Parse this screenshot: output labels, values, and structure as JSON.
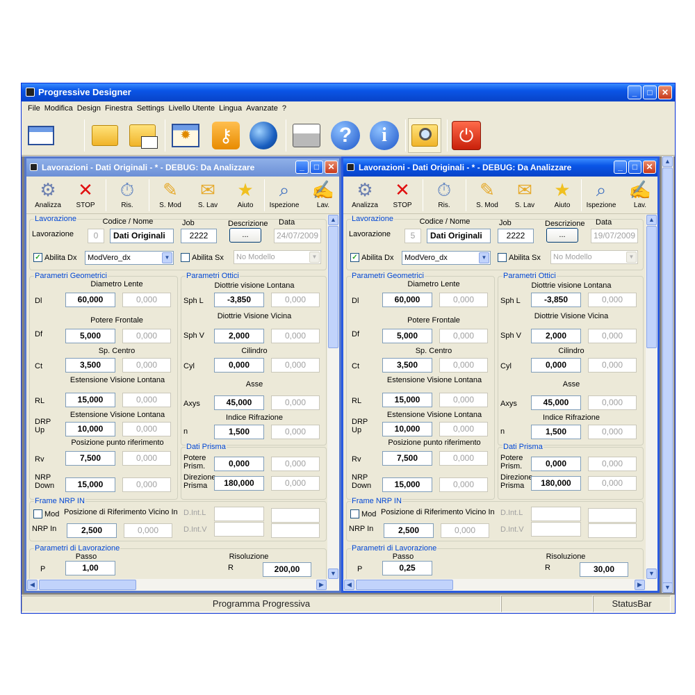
{
  "app": {
    "title": "Progressive Designer",
    "menu": [
      "File",
      "Modifica",
      "Design",
      "Finestra",
      "Settings",
      "Livello Utente",
      "Lingua",
      "Avanzate",
      "?"
    ],
    "toolbar_icons": [
      "window-icon",
      "open-folder-icon",
      "folder-grid-icon",
      "settings-window-icon",
      "key-icon",
      "globe-icon",
      "printer-icon",
      "help-icon",
      "info-icon",
      "search-folder-icon",
      "power-icon"
    ],
    "status": {
      "center": "Programma Progressiva",
      "right": "StatusBar"
    }
  },
  "toolbar_labels": {
    "analizza": "Analizza",
    "stop": "STOP",
    "ris": "Ris.",
    "smod": "S. Mod",
    "slav": "S. Lav",
    "aiuto": "Aiuto",
    "ispezione": "Ispezione",
    "lav": "Lav."
  },
  "labels": {
    "lavorazione_group": "Lavorazione",
    "codice_nome": "Codice / Nome",
    "job": "Job",
    "descrizione": "Descrizione",
    "data": "Data",
    "lavorazione": "Lavorazione",
    "abilita_dx": "Abilita Dx",
    "abilita_sx": "Abilita Sx",
    "param_geom": "Parametri Geometrici",
    "param_ottici": "Parametri Ottici",
    "diametro_lente": "Diametro Lente",
    "potere_frontale": "Potere Frontale",
    "sp_centro": "Sp. Centro",
    "est_vis_lontana": "Estensione Visione Lontana",
    "pos_punto_rif": "Posizione punto riferimento",
    "diottrie_lontana": "Diottrie visione Lontana",
    "diottrie_vicina": "Diottrie Visione Vicina",
    "cilindro": "Cilindro",
    "asse": "Asse",
    "indice_rifrazione": "Indice Rifrazione",
    "dati_prisma": "Dati Prisma",
    "frame_nrp": "Frame NRP  IN",
    "mod": "Mod",
    "pos_rif_vicino": "Posizione di Riferimento Vicino In",
    "nrp_in": "NRP In",
    "dintl": "D.Int.L",
    "dintv": "D.Int.V",
    "param_lav": "Parametri di Lavorazione",
    "passo": "Passo",
    "risoluzione": "Risoluzione",
    "p": "P",
    "r": "R",
    "dl": "Dl",
    "df": "Df",
    "ct": "Ct",
    "rl": "RL",
    "drp": "DRP",
    "up": "Up",
    "rv": "Rv",
    "nrp": "NRP",
    "down": "Down",
    "sphl": "Sph L",
    "sphv": "Sph V",
    "cyl": "Cyl",
    "axys": "Axys",
    "n": "n",
    "potere": "Potere",
    "prism": "Prism.",
    "direzione": "Direzione",
    "prisma": "Prisma",
    "dots": "...",
    "no_modello": "No Modello"
  },
  "windows": [
    {
      "title": "Lavorazioni - Dati Originali - *  - DEBUG: Da Analizzare",
      "codice": "0",
      "nome": "Dati Originali",
      "job": "2222",
      "data": "24/07/2009",
      "modello": "ModVero_dx",
      "abilita_dx": true,
      "abilita_sx": false,
      "dl": "60,000",
      "df": "5,000",
      "ct": "3,500",
      "rl": "15,000",
      "drp_up": "10,000",
      "rv": "7,500",
      "nrp_down": "15,000",
      "sphl": "-3,850",
      "sphv": "2,000",
      "cyl": "0,000",
      "axys": "45,000",
      "n": "1,500",
      "potere_prism": "0,000",
      "direzione_prisma": "180,000",
      "nrp_in": "2,500",
      "passo": "1,00",
      "risoluzione": "200,00",
      "zero": "0,000"
    },
    {
      "title": "Lavorazioni - Dati Originali - *  - DEBUG: Da Analizzare",
      "codice": "5",
      "nome": "Dati Originali",
      "job": "2222",
      "data": "19/07/2009",
      "modello": "ModVero_dx",
      "abilita_dx": true,
      "abilita_sx": false,
      "dl": "60,000",
      "df": "5,000",
      "ct": "3,500",
      "rl": "15,000",
      "drp_up": "10,000",
      "rv": "7,500",
      "nrp_down": "15,000",
      "sphl": "-3,850",
      "sphv": "2,000",
      "cyl": "0,000",
      "axys": "45,000",
      "n": "1,500",
      "potere_prism": "0,000",
      "direzione_prisma": "180,000",
      "nrp_in": "2,500",
      "passo": "0,25",
      "risoluzione": "30,00",
      "zero": "0,000"
    }
  ]
}
